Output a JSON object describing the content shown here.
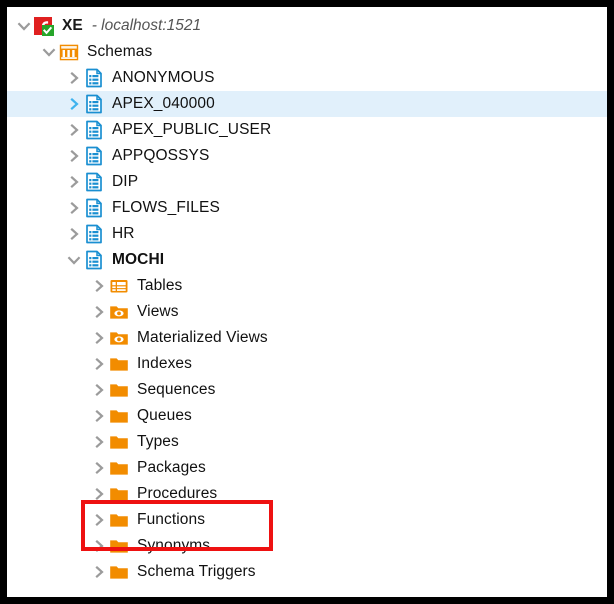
{
  "window": {
    "title": "Database Connections Tree",
    "border_color": "#000000",
    "background": "#ffffff"
  },
  "colors": {
    "selection_background": "#e1f0fb",
    "selection_arrow": "#3fb3ee",
    "arrow": "#9b9b9b",
    "folder_orange": "#f28c00",
    "schema_blue": "#1a8fd1",
    "annotation_red": "#ee1111",
    "connection_red": "#e02020",
    "check_green": "#27a52a",
    "host_text": "#555555"
  },
  "annotation": {
    "type": "rectangle-highlight",
    "color": "#ee1111",
    "targets": [
      "Procedures",
      "Functions"
    ]
  },
  "tree": {
    "connection": {
      "name": "XE",
      "separator": "-",
      "host": "localhost:1521",
      "icon": "database-connection-icon",
      "expanded": true,
      "depth": 0
    },
    "nodes": [
      {
        "label": "Schemas",
        "icon": "schemas-icon",
        "depth": 1,
        "state": "expanded",
        "selected": false,
        "bold": false
      },
      {
        "label": "ANONYMOUS",
        "icon": "schema-icon",
        "depth": 2,
        "state": "collapsed",
        "selected": false,
        "bold": false
      },
      {
        "label": "APEX_040000",
        "icon": "schema-icon",
        "depth": 2,
        "state": "collapsed",
        "selected": true,
        "bold": false
      },
      {
        "label": "APEX_PUBLIC_USER",
        "icon": "schema-icon",
        "depth": 2,
        "state": "collapsed",
        "selected": false,
        "bold": false
      },
      {
        "label": "APPQOSSYS",
        "icon": "schema-icon",
        "depth": 2,
        "state": "collapsed",
        "selected": false,
        "bold": false
      },
      {
        "label": "DIP",
        "icon": "schema-icon",
        "depth": 2,
        "state": "collapsed",
        "selected": false,
        "bold": false
      },
      {
        "label": "FLOWS_FILES",
        "icon": "schema-icon",
        "depth": 2,
        "state": "collapsed",
        "selected": false,
        "bold": false
      },
      {
        "label": "HR",
        "icon": "schema-icon",
        "depth": 2,
        "state": "collapsed",
        "selected": false,
        "bold": false
      },
      {
        "label": "MOCHI",
        "icon": "schema-icon",
        "depth": 2,
        "state": "expanded",
        "selected": false,
        "bold": true
      },
      {
        "label": "Tables",
        "icon": "tables-icon",
        "depth": 3,
        "state": "collapsed",
        "selected": false,
        "bold": false
      },
      {
        "label": "Views",
        "icon": "views-folder-icon",
        "depth": 3,
        "state": "collapsed",
        "selected": false,
        "bold": false
      },
      {
        "label": "Materialized Views",
        "icon": "views-folder-icon",
        "depth": 3,
        "state": "collapsed",
        "selected": false,
        "bold": false
      },
      {
        "label": "Indexes",
        "icon": "folder-icon",
        "depth": 3,
        "state": "collapsed",
        "selected": false,
        "bold": false
      },
      {
        "label": "Sequences",
        "icon": "folder-icon",
        "depth": 3,
        "state": "collapsed",
        "selected": false,
        "bold": false
      },
      {
        "label": "Queues",
        "icon": "folder-icon",
        "depth": 3,
        "state": "collapsed",
        "selected": false,
        "bold": false
      },
      {
        "label": "Types",
        "icon": "folder-icon",
        "depth": 3,
        "state": "collapsed",
        "selected": false,
        "bold": false
      },
      {
        "label": "Packages",
        "icon": "folder-icon",
        "depth": 3,
        "state": "collapsed",
        "selected": false,
        "bold": false
      },
      {
        "label": "Procedures",
        "icon": "folder-icon",
        "depth": 3,
        "state": "collapsed",
        "selected": false,
        "bold": false
      },
      {
        "label": "Functions",
        "icon": "folder-icon",
        "depth": 3,
        "state": "collapsed",
        "selected": false,
        "bold": false
      },
      {
        "label": "Synonyms",
        "icon": "folder-icon",
        "depth": 3,
        "state": "collapsed",
        "selected": false,
        "bold": false
      },
      {
        "label": "Schema Triggers",
        "icon": "folder-icon",
        "depth": 3,
        "state": "collapsed",
        "selected": false,
        "bold": false
      }
    ]
  }
}
